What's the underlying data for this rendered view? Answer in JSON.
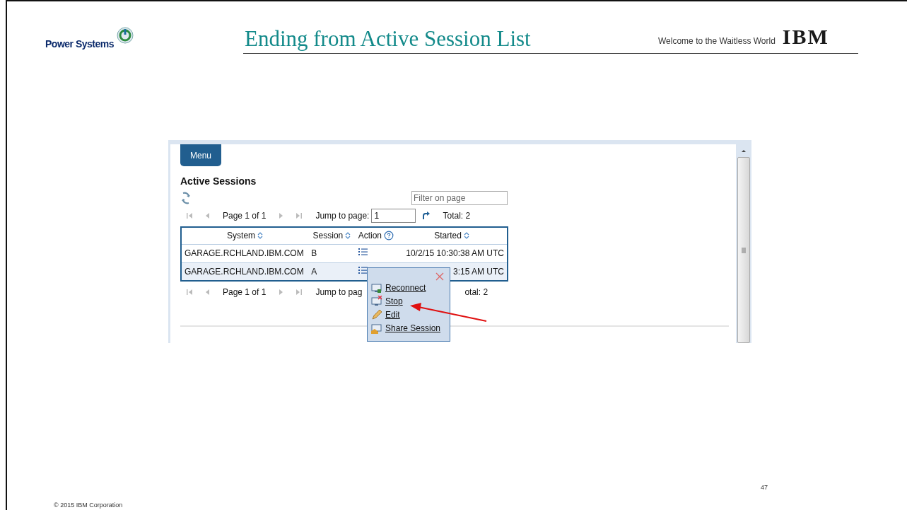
{
  "slide": {
    "brand": "Power Systems",
    "title": "Ending from Active Session List",
    "tagline": "Welcome to the Waitless World",
    "logo": "IBM",
    "page_number": "47",
    "copyright": "© 2015 IBM Corporation"
  },
  "app": {
    "menu_button": "Menu",
    "heading": "Active Sessions",
    "filter": {
      "placeholder": "Filter on page"
    },
    "pager_top": {
      "page": "Page 1 of 1",
      "jump_label": "Jump to page:",
      "jump_value": "1",
      "total": "Total: 2"
    },
    "table": {
      "columns": [
        {
          "label": "System",
          "kind": "sortable"
        },
        {
          "label": "Session",
          "kind": "sortable"
        },
        {
          "label": "Action",
          "kind": "help"
        },
        {
          "label": "Started",
          "kind": "sortable"
        }
      ],
      "rows": [
        {
          "system": "GARAGE.RCHLAND.IBM.COM",
          "session": "B",
          "started": "10/2/15 10:30:38 AM UTC",
          "selected": false
        },
        {
          "system": "GARAGE.RCHLAND.IBM.COM",
          "session": "A",
          "started": "3:15 AM UTC",
          "selected": true
        }
      ]
    },
    "pager_bottom": {
      "page": "Page 1 of 1",
      "jump_label": "Jump to pag",
      "total": "otal: 2"
    },
    "context_menu": {
      "items": [
        {
          "kind": "reconnect",
          "label": "Reconnect"
        },
        {
          "kind": "stop",
          "label": "Stop"
        },
        {
          "kind": "edit",
          "label": "Edit"
        },
        {
          "kind": "share",
          "label": "Share Session"
        }
      ]
    }
  }
}
